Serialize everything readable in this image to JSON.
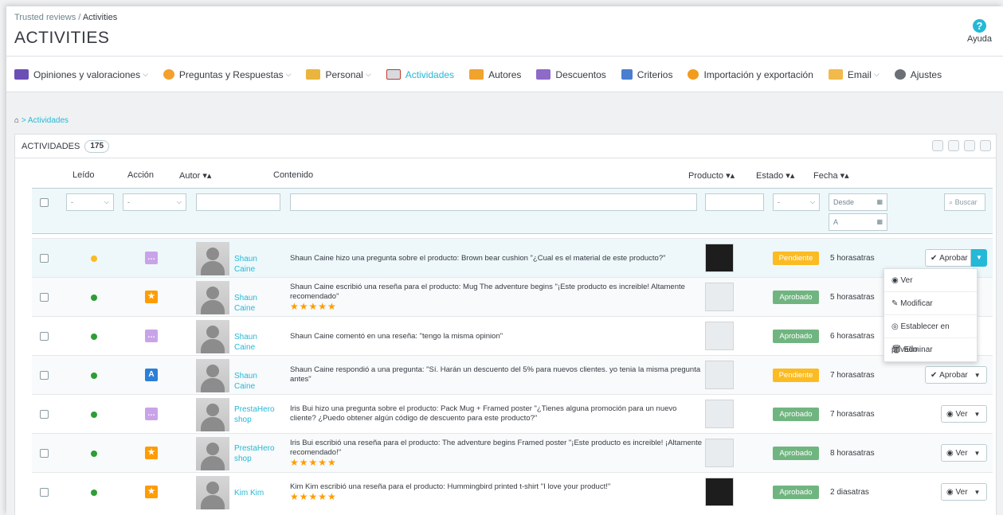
{
  "header": {
    "breadcrumb_parent": "Trusted reviews",
    "breadcrumb_sep": "/",
    "breadcrumb_current": "Activities",
    "title": "ACTIVITIES",
    "help_label": "Ayuda"
  },
  "tabs": [
    {
      "label": "Opiniones y valoraciones",
      "icon": "reviews-icon",
      "dropdown": true
    },
    {
      "label": "Preguntas y Respuestas",
      "icon": "qa-icon",
      "dropdown": true
    },
    {
      "label": "Personal",
      "icon": "staff-icon",
      "dropdown": true
    },
    {
      "label": "Actividades",
      "icon": "activities-icon",
      "active": true
    },
    {
      "label": "Autores",
      "icon": "authors-icon"
    },
    {
      "label": "Descuentos",
      "icon": "discounts-icon"
    },
    {
      "label": "Criterios",
      "icon": "criteria-icon"
    },
    {
      "label": "Importación y exportación",
      "icon": "import-export-icon"
    },
    {
      "label": "Email",
      "icon": "email-icon",
      "dropdown": true
    },
    {
      "label": "Ajustes",
      "icon": "settings-icon"
    }
  ],
  "sub_breadcrumb": {
    "sep": ">",
    "current": "Actividades"
  },
  "panel": {
    "title": "ACTIVIDADES",
    "count": "175"
  },
  "columns": {
    "leido": "Leído",
    "accion": "Acción",
    "autor": "Autor ▾▴",
    "contenido": "Contenido",
    "producto": "Producto ▾▴",
    "estado": "Estado ▾▴",
    "fecha": "Fecha ▾▴"
  },
  "filters": {
    "select_default": "-",
    "desde": "Desde",
    "a": "A",
    "buscar": "Buscar"
  },
  "rows": [
    {
      "read_color": "#fbbb22",
      "action_icon": "question-icon",
      "action_color": "#c9a3e8",
      "action_glyph": "…",
      "author": "Shaun Caine",
      "content": "Shaun Caine hizo una pregunta sobre el producto: Brown bear cushion \"¿Cual es el material de este producto?\"",
      "stars": "",
      "status": "Pendiente",
      "status_color": "#fbbb22",
      "date": "5 horasatras",
      "button": "Aprobar"
    },
    {
      "read_color": "#2d9d36",
      "action_icon": "review-star-icon",
      "action_color": "#ff9c00",
      "action_glyph": "★",
      "author": "Shaun Caine",
      "content": "Shaun Caine escribió una reseña para el producto: Mug The adventure begins \"¡Este producto es increible! Altamente recomendado\"",
      "stars": "★★★★★",
      "status": "Aprobado",
      "status_color": "#70b580",
      "date": "5 horasatras",
      "button": ""
    },
    {
      "read_color": "#2d9d36",
      "action_icon": "comment-icon",
      "action_color": "#c9a3e8",
      "action_glyph": "…",
      "author": "Shaun Caine",
      "content": "Shaun Caine comentó en una reseña: \"tengo la misma opinion\"",
      "stars": "",
      "status": "Aprobado",
      "status_color": "#70b580",
      "date": "6 horasatras",
      "button": ""
    },
    {
      "read_color": "#2d9d36",
      "action_icon": "answer-icon",
      "action_color": "#2b7fd6",
      "action_glyph": "A",
      "author": "Shaun Caine",
      "content": "Shaun Caine respondió a una pregunta: \"Sí. Harán un descuento del 5% para nuevos clientes. yo tenia la misma pregunta antes\"",
      "stars": "",
      "status": "Pendiente",
      "status_color": "#fbbb22",
      "date": "7 horasatras",
      "button": "Aprobar"
    },
    {
      "read_color": "#2d9d36",
      "action_icon": "question-icon",
      "action_color": "#c9a3e8",
      "action_glyph": "…",
      "author": "PrestaHero shop",
      "content": "Iris Bui hizo una pregunta sobre el producto: Pack Mug + Framed poster \"¿Tienes alguna promoción para un nuevo cliente? ¿Puedo obtener algún código de descuento para este producto?\"",
      "stars": "",
      "status": "Aprobado",
      "status_color": "#70b580",
      "date": "7 horasatras",
      "button": "Ver"
    },
    {
      "read_color": "#2d9d36",
      "action_icon": "review-star-icon",
      "action_color": "#ff9c00",
      "action_glyph": "★",
      "author": "PrestaHero shop",
      "content": "Iris Bui escribió una reseña para el producto: The adventure begins Framed poster \"¡Este producto es increible! ¡Altamente recomendado!\"",
      "stars": "★★★★★",
      "status": "Aprobado",
      "status_color": "#70b580",
      "date": "8 horasatras",
      "button": "Ver"
    },
    {
      "read_color": "#2d9d36",
      "action_icon": "review-star-icon",
      "action_color": "#ff9c00",
      "action_glyph": "★",
      "author": "Kim Kim",
      "content": "Kim Kim escribió una reseña para el producto: Hummingbird printed t-shirt \"I love your product!\"",
      "stars": "★★★★★",
      "status": "Aprobado",
      "status_color": "#70b580",
      "date": "2 diasatras",
      "button": "Ver"
    }
  ],
  "dropdown_menu": [
    "Ver",
    "Modificar",
    "Establecer en privado",
    "Eliminar"
  ]
}
